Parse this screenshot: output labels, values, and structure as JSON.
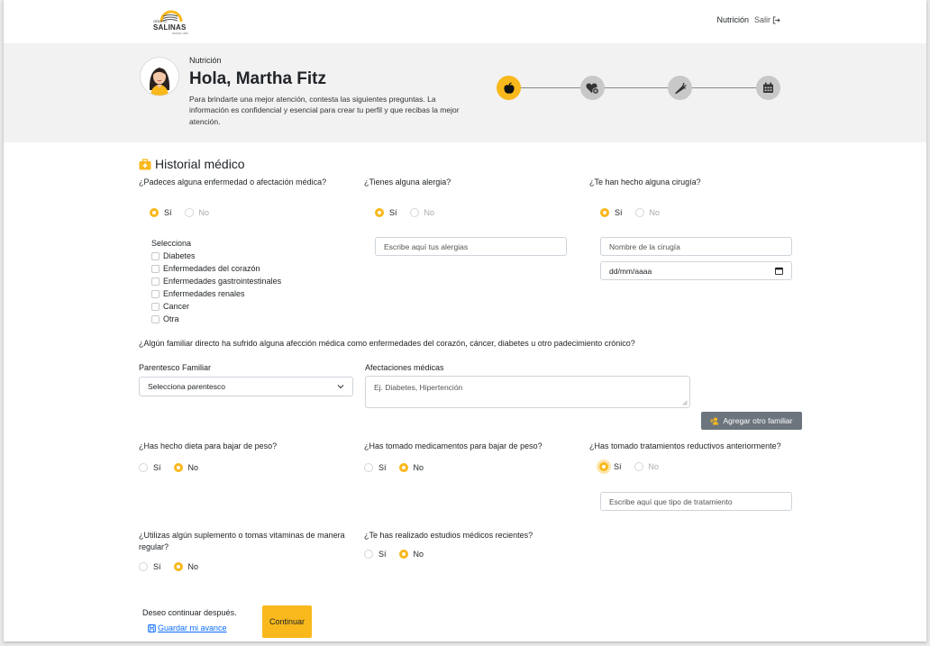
{
  "nav": {
    "logo_small": "GRUPO",
    "logo_text": "SALINAS",
    "logo_sub": "DESDE 1906",
    "nutrition": "Nutrición",
    "logout": "Salir"
  },
  "header": {
    "section": "Nutrición",
    "greeting": "Hola, Martha Fitz",
    "description": "Para brindarte una mejor atención, contesta las siguientes preguntas. La información es confidencial y esencial para crear tu perfil y que recibas la mejor atención.",
    "steps": [
      {
        "icon": "apple-icon",
        "active": true
      },
      {
        "icon": "heart-plus-icon",
        "active": false
      },
      {
        "icon": "carrot-icon",
        "active": false
      },
      {
        "icon": "calendar-icon",
        "active": false
      }
    ]
  },
  "colors": {
    "accent": "#f9b81b",
    "step_inactive": "#c8c8c8",
    "header_bg": "#f2f2f2",
    "link": "#0d6efd"
  },
  "section": {
    "title": "Historial médico",
    "icon": "briefcase-medical-icon"
  },
  "yes": "Sí",
  "no": "No",
  "q1": {
    "question": "¿Padeces alguna enfermedad o afectación médica?",
    "answer": "Sí",
    "select_label": "Selecciona",
    "options": [
      "Diabetes",
      "Enfermedades del corazón",
      "Enfermedades gastrointestinales",
      "Enfermedades renales",
      "Cancer",
      "Otra"
    ]
  },
  "q2": {
    "question": "¿Tienes alguna alergia?",
    "answer": "Sí",
    "placeholder": "Escribe aquí tus alergias"
  },
  "q3": {
    "question": "¿Te han hecho alguna cirugía?",
    "answer": "Sí",
    "name_placeholder": "Nombre de la cirugía",
    "date_placeholder": "dd/mm/aaaa"
  },
  "family": {
    "question": "¿Algún familiar directo ha sufrido alguna afección médica como enfermedades del corazón, cáncer, diabetes u otro padecimiento crónico?",
    "relation_label": "Parentesco Familiar",
    "relation_value": "Selecciona parentesco",
    "conditions_label": "Afectaciones médicas",
    "conditions_placeholder": "Ej. Diabetes, Hipertención",
    "add_button": "Agregar otro familiar"
  },
  "q4": {
    "question": "¿Has hecho dieta para bajar de peso?",
    "answer": "No"
  },
  "q5": {
    "question": "¿Has tomado medicamentos para bajar de peso?",
    "answer": "No"
  },
  "q6": {
    "question": "¿Has tomado tratamientos reductivos anteriormente?",
    "answer": "Sí",
    "placeholder": "Escribe aquí que tipo de tratamiento"
  },
  "q7": {
    "question": "¿Utilizas algún suplemento o tomas vitaminas de manera regular?",
    "answer": "No"
  },
  "q8": {
    "question": "¿Te has realizado estudios médicos recientes?",
    "answer": "No"
  },
  "footer": {
    "later_text": "Deseo continuar después.",
    "save_link": "Guardar mi avance",
    "continue_button": "Continuar"
  }
}
